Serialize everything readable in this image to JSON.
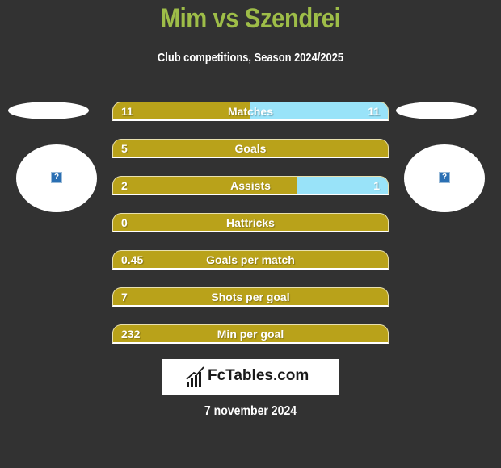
{
  "header": {
    "title": "Mim vs Szendrei",
    "subtitle": "Club competitions, Season 2024/2025"
  },
  "players": {
    "left": {
      "name": "Mim",
      "image_icon": "broken-image-icon"
    },
    "right": {
      "name": "Szendrei",
      "image_icon": "broken-image-icon"
    }
  },
  "colors": {
    "left_bar": "#b9a21a",
    "right_bar": "#99e3f9",
    "title": "#9ebd48",
    "background": "#323232"
  },
  "stats": [
    {
      "label": "Matches",
      "left": "11",
      "right": "11",
      "right_share": 0.5
    },
    {
      "label": "Goals",
      "left": "5",
      "right": "",
      "right_share": 0
    },
    {
      "label": "Assists",
      "left": "2",
      "right": "1",
      "right_share": 0.333
    },
    {
      "label": "Hattricks",
      "left": "0",
      "right": "",
      "right_share": 0
    },
    {
      "label": "Goals per match",
      "left": "0.45",
      "right": "",
      "right_share": 0
    },
    {
      "label": "Shots per goal",
      "left": "7",
      "right": "",
      "right_share": 0
    },
    {
      "label": "Min per goal",
      "left": "232",
      "right": "",
      "right_share": 0
    }
  ],
  "footer": {
    "logo_text": "FcTables.com",
    "date": "7 november 2024"
  }
}
